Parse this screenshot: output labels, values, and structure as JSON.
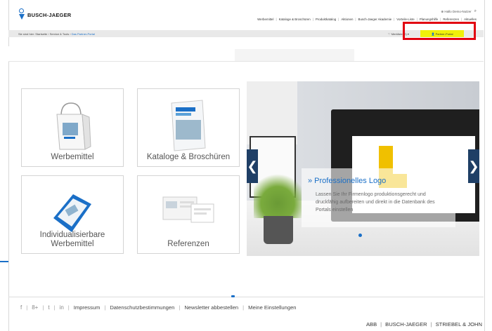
{
  "header": {
    "brand": "BUSCH-JAEGER",
    "util_login": "⊕ Hallo Demo-Nutzer",
    "util_search_icon": "search-icon",
    "nav": [
      "Werbemittel",
      "Kataloge & Broschüren",
      "Produktkatalog",
      "Aktionen",
      "Busch-Jaeger Akademie",
      "Vorteile-Liste",
      "Planungshilfe",
      "Referenzen",
      "Aktuelles"
    ],
    "nav_sep": "|"
  },
  "subbar": {
    "breadcrumb": [
      "Sie sind hier:",
      "Startseite",
      "Service & Tools"
    ],
    "breadcrumb_current": "Das Partner-Portal",
    "watchlist": "Merkliste (0)",
    "portal_button": "Partner-Portal"
  },
  "tiles": [
    {
      "label": "Werbemittel"
    },
    {
      "label": "Kataloge & Broschüren"
    },
    {
      "label": "Individualisierbare Werbemittel"
    },
    {
      "label": "Referenzen"
    }
  ],
  "slider": {
    "title": "» Professionelles Logo",
    "text": "Lassen Sie Ihr Firmenlogo produktionsgerecht und druckfähig aufbereiten und direkt in die Datenbank des Portals einstellen",
    "prev_icon": "chevron-left-icon",
    "next_icon": "chevron-right-icon",
    "prev_glyph": "❮",
    "next_glyph": "❯",
    "dots": 8,
    "active_dot": 5
  },
  "footer": {
    "social": [
      "f",
      "8+",
      "t",
      "in"
    ],
    "links": [
      "Impressum",
      "Datenschutzbestimmungen",
      "Newsletter abbestellen",
      "Meine Einstellungen"
    ],
    "brands": [
      "ABB",
      "BUSCH-JAEGER",
      "STRIEBEL & JOHN"
    ]
  },
  "colors": {
    "accent": "#1a6fc7",
    "highlight": "#e10010",
    "portal_btn": "#f0f00a"
  }
}
